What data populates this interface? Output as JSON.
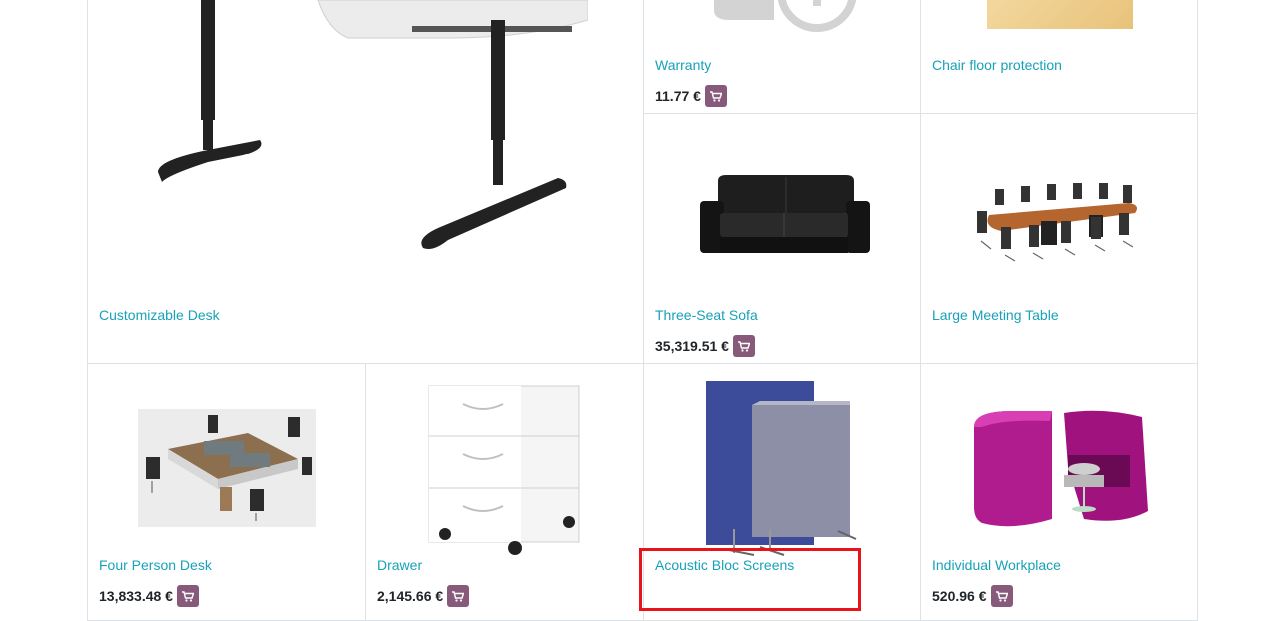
{
  "currency": "€",
  "products": {
    "desk": {
      "name": "Customizable Desk"
    },
    "warranty": {
      "name": "Warranty",
      "price": "11.77 €"
    },
    "chair_protection": {
      "name": "Chair floor protection"
    },
    "sofa": {
      "name": "Three-Seat Sofa",
      "price": "35,319.51 €"
    },
    "meeting_table": {
      "name": "Large Meeting Table"
    },
    "four_desk": {
      "name": "Four Person Desk",
      "price": "13,833.48 €"
    },
    "drawer": {
      "name": "Drawer",
      "price": "2,145.66 €"
    },
    "acoustic": {
      "name": "Acoustic Bloc Screens"
    },
    "workplace": {
      "name": "Individual Workplace",
      "price": "520.96 €"
    }
  },
  "icons": {
    "cart": "shopping-cart-icon"
  },
  "colors": {
    "link": "#17a2b8",
    "cart_button": "#875a7b",
    "highlight": "#e8141b",
    "border": "#dee2e6"
  }
}
